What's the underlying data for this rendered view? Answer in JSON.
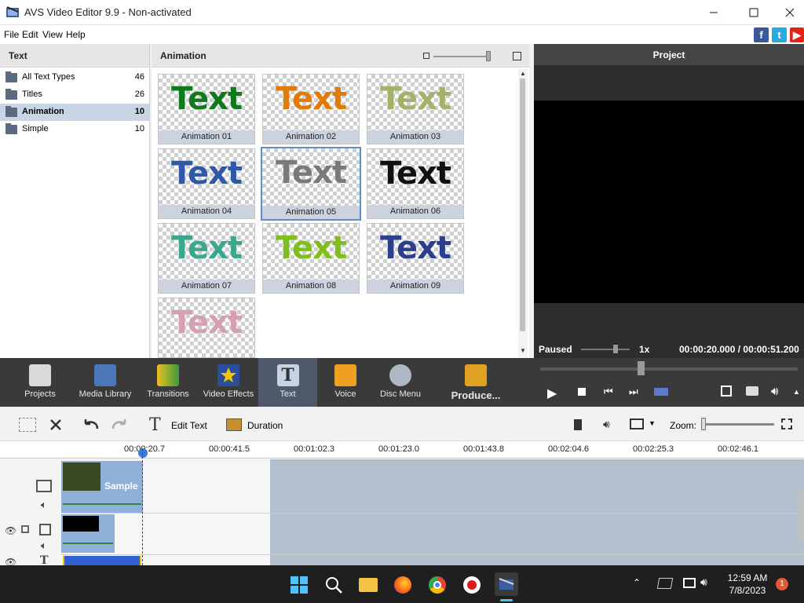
{
  "window": {
    "title": "AVS Video Editor 9.9 - Non-activated"
  },
  "menu": [
    "File",
    "Edit",
    "View",
    "Help"
  ],
  "left_panel": {
    "header": "Text",
    "items": [
      {
        "label": "All Text Types",
        "count": "46"
      },
      {
        "label": "Titles",
        "count": "26"
      },
      {
        "label": "Animation",
        "count": "10",
        "selected": true
      },
      {
        "label": "Simple",
        "count": "10"
      }
    ]
  },
  "mid_panel": {
    "header": "Animation",
    "tiles": [
      {
        "word": "Text",
        "caption": "Animation 01",
        "color": "#0f7a1c"
      },
      {
        "word": "Text",
        "caption": "Animation 02",
        "color": "#e27a05"
      },
      {
        "word": "Text",
        "caption": "Animation 03",
        "color": "#a3b26a"
      },
      {
        "word": "Text",
        "caption": "Animation 04",
        "color": "#2f58a8"
      },
      {
        "word": "Text",
        "caption": "Animation 05",
        "color": "#7a7a7a"
      },
      {
        "word": "Text",
        "caption": "Animation 06",
        "color": "#111111"
      },
      {
        "word": "Text",
        "caption": "Animation 07",
        "color": "#3aa88c"
      },
      {
        "word": "Text",
        "caption": "Animation 08",
        "color": "#7fbf1a"
      },
      {
        "word": "Text",
        "caption": "Animation 09",
        "color": "#2c3f8c"
      },
      {
        "word": "Text",
        "caption": "",
        "color": "#d7a0b0"
      }
    ]
  },
  "preview": {
    "header": "Project",
    "status": "Paused",
    "speed": "1x",
    "time": "00:00:20.000 / 00:00:51.200"
  },
  "toolbar": {
    "buttons": [
      {
        "label": "Projects"
      },
      {
        "label": "Media Library"
      },
      {
        "label": "Transitions"
      },
      {
        "label": "Video Effects"
      },
      {
        "label": "Text",
        "active": true
      },
      {
        "label": "Voice"
      },
      {
        "label": "Disc Menu"
      },
      {
        "label": "Produce..."
      }
    ]
  },
  "edit_tools": {
    "edit_text": "Edit Text",
    "duration": "Duration",
    "zoom_label": "Zoom:"
  },
  "ruler": [
    "00:00:20.7",
    "00:00:41.5",
    "00:01:02.3",
    "00:01:23.0",
    "00:01:43.8",
    "00:02:04.6",
    "00:02:25.3",
    "00:02:46.1"
  ],
  "timeline": {
    "clip_label": "Sample"
  },
  "taskbar": {
    "time": "12:59 AM",
    "date": "7/8/2023",
    "badge": "1"
  },
  "colors": {
    "accent": "#5b8fc8",
    "toolbar": "#3a3a3a",
    "selection": "#c9d4e4"
  }
}
